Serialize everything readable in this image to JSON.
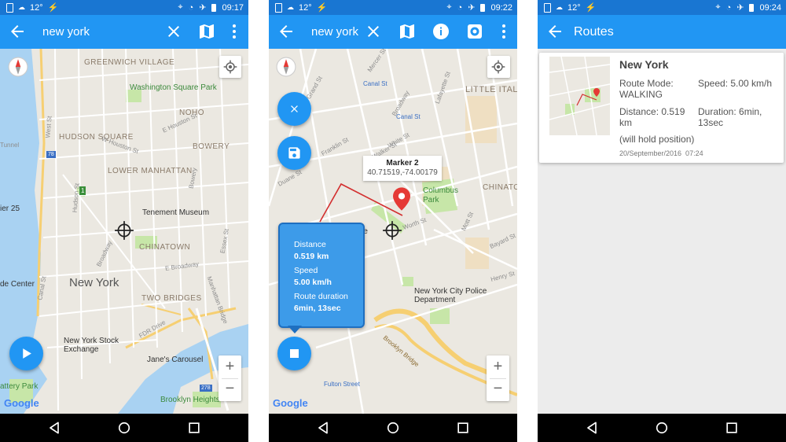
{
  "status": {
    "temp": "12°",
    "time1": "09:17",
    "time2": "09:22",
    "time3": "09:24"
  },
  "screen1": {
    "search_query": "new york",
    "map_labels": {
      "greenwich_village": "GREENWICH VILLAGE",
      "washington_square_park": "Washington Square Park",
      "noho": "NOHO",
      "hudson_square": "HUDSON SQUARE",
      "bowery": "BOWERY",
      "lower_manhattan": "LOWER MANHATTAN",
      "tenement_museum": "Tenement Museum",
      "chinatown": "CHINATOWN",
      "new_york": "New York",
      "two_bridges": "TWO BRIDGES",
      "pier25": "ier 25",
      "de_center": "de Center",
      "stock_exchange": "New York Stock Exchange",
      "janes_carousel": "Jane's Carousel",
      "brooklyn_heights": "Brooklyn Heights",
      "battery_park": "attery Park",
      "tunnel": "Tunnel",
      "w_houston": "W Houston St",
      "e_houston": "E Houston St",
      "broadway": "Broadway",
      "e_broadway": "E Broadway",
      "fdr_drive": "FDR Drive",
      "manhattan_bridge": "Manhattan Bridge",
      "hudson_st": "Hudson St",
      "west_st": "West St",
      "bowery_st": "Bowery",
      "canal_st": "Canal St",
      "essex_st": "Essex St",
      "st_1": "1",
      "route_78": "78",
      "route_278": "278"
    }
  },
  "screen2": {
    "search_query": "new york",
    "marker": {
      "name": "Marker 2",
      "coords": "40.71519,-74.00179"
    },
    "stats": {
      "distance_label": "Distance",
      "distance_value": "0.519 km",
      "speed_label": "Speed",
      "speed_value": "5.00 km/h",
      "duration_label": "Route duration",
      "duration_value": "6min, 13sec"
    },
    "map_labels": {
      "canal_st_top": "Canal St",
      "canal_st_mid": "Canal St",
      "little_italy": "LITTLE ITAL",
      "chinatown": "CHINATO",
      "columbus_park": "Columbus Park",
      "nypd": "New York City Police Department",
      "fulton_st": "Fulton Street",
      "grand_st": "Grand St",
      "lafayette_st": "Lafayette St",
      "mercer_st": "Mercer St",
      "broadway": "Broadway",
      "walker_st": "Walker St",
      "white_st": "White St",
      "franklin_st": "Franklin St",
      "duane_st": "Duane St",
      "worth_st": "Worth St",
      "henry_st": "Henry St",
      "bayard_st": "Bayard St",
      "brooklyn_bridge": "Brooklyn Bridge",
      "re": "re",
      "mott_st": "Mott St"
    }
  },
  "screen3": {
    "title": "Routes",
    "route": {
      "name": "New York",
      "mode_label": "Route Mode:",
      "mode_value": "WALKING",
      "speed": "Speed: 5.00 km/h",
      "distance_label": "Distance: 0.519",
      "distance_unit": "km",
      "duration_label": "Duration: 6min,",
      "duration_rest": "13sec",
      "note": "(will hold position)",
      "date": "20/September/2016  07:24"
    }
  },
  "google_logo": "Google",
  "colors": {
    "status_bar": "#1976d2",
    "app_bar": "#2196f3",
    "map_bg": "#ebe8e1",
    "water": "#a9d2f2",
    "park": "#c7e6a8",
    "route_line": "#d32f2f",
    "marker": "#e53935"
  },
  "icons": [
    "back-arrow-icon",
    "close-icon",
    "map-icon",
    "more-vert-icon",
    "info-icon",
    "settings-icon",
    "compass-icon",
    "my-location-icon",
    "play-icon",
    "stop-icon",
    "save-icon",
    "crosshair-icon",
    "zoom-in-icon",
    "zoom-out-icon",
    "nav-back-icon",
    "nav-home-icon",
    "nav-recents-icon",
    "sim-icon",
    "weather-icon",
    "signal-icon",
    "location-icon",
    "wifi-icon",
    "airplane-icon",
    "bolt-icon"
  ]
}
